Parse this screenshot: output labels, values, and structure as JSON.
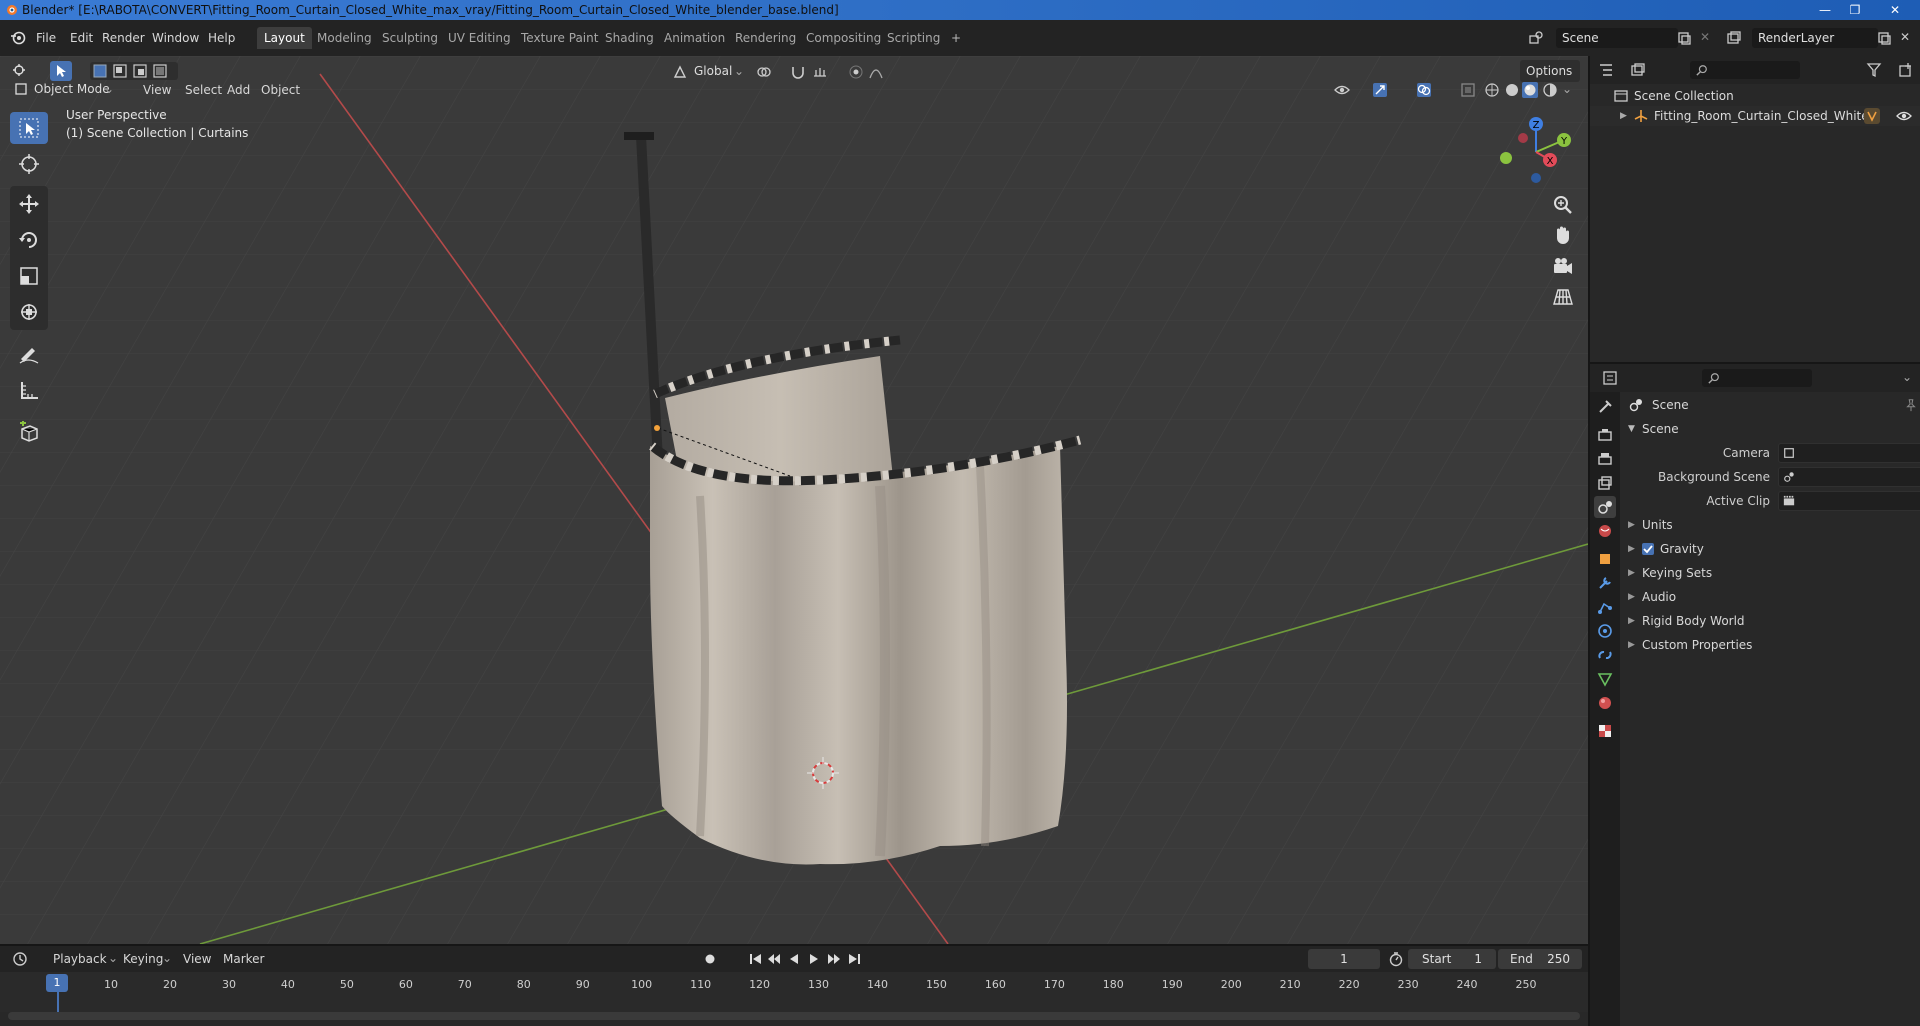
{
  "window": {
    "title": "Blender* [E:\\RABOTA\\CONVERT\\Fitting_Room_Curtain_Closed_White_max_vray/Fitting_Room_Curtain_Closed_White_blender_base.blend]"
  },
  "menu": {
    "items": [
      "File",
      "Edit",
      "Render",
      "Window",
      "Help"
    ]
  },
  "workspaces": {
    "tabs": [
      "Layout",
      "Modeling",
      "Sculpting",
      "UV Editing",
      "Texture Paint",
      "Shading",
      "Animation",
      "Rendering",
      "Compositing",
      "Scripting"
    ],
    "active": "Layout",
    "add": "+"
  },
  "scene_selector": {
    "value": "Scene"
  },
  "view_layer_selector": {
    "value": "RenderLayer"
  },
  "viewport": {
    "mode": "Object Mode",
    "menus": [
      "View",
      "Select",
      "Add",
      "Object"
    ],
    "transform_orientation": "Global",
    "options_label": "Options",
    "overlay_line1": "User Perspective",
    "overlay_line2": "(1) Scene Collection | Curtains",
    "gizmo": {
      "x": "X",
      "y": "Y",
      "z": "Z"
    }
  },
  "outliner": {
    "root": "Scene Collection",
    "items": [
      "Fitting_Room_Curtain_Closed_White"
    ]
  },
  "properties": {
    "context": "Scene",
    "panel": "Scene",
    "fields": [
      {
        "label": "Camera"
      },
      {
        "label": "Background Scene"
      },
      {
        "label": "Active Clip"
      }
    ],
    "subpanels": [
      "Units",
      "Gravity",
      "Keying Sets",
      "Audio",
      "Rigid Body World",
      "Custom Properties"
    ],
    "gravity_checked": true
  },
  "timeline": {
    "menus": [
      "Playback",
      "Keying",
      "View",
      "Marker"
    ],
    "current_frame": "1",
    "start_label": "Start",
    "start_value": "1",
    "end_label": "End",
    "end_value": "250",
    "frame_labels": [
      "1",
      "10",
      "20",
      "30",
      "40",
      "50",
      "60",
      "70",
      "80",
      "90",
      "100",
      "110",
      "120",
      "130",
      "140",
      "150",
      "160",
      "170",
      "180",
      "190",
      "200",
      "210",
      "220",
      "230",
      "240",
      "250"
    ]
  },
  "colors": {
    "accent": "#4772b3",
    "x_axis": "#e34b59",
    "y_axis": "#8bc33f",
    "z_axis": "#3f7fe3",
    "viewport_bg": "#3a3a3a"
  }
}
